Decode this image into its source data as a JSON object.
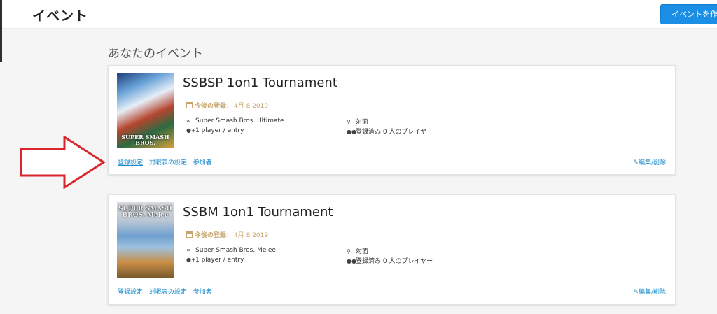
{
  "header": {
    "title": "イベント",
    "create_button": "イベントを作"
  },
  "section_title": "あなたのイベント",
  "colors": {
    "accent": "#1a8ccd",
    "button": "#1b8ee6",
    "date": "#c7a46a",
    "arrow": "#d9262c"
  },
  "events": [
    {
      "title": "SSBSP 1on1 Tournament",
      "thumb_logo": "SUPER SMASH BROS.",
      "date_label": "今後の登録：",
      "date_value": "4月 8 2019",
      "game": "Super Smash Bros. Ultimate",
      "entry": "1 player / entry",
      "venue": "対面",
      "players": "登録済み 0 人のプレイヤー",
      "links": [
        "登録設定",
        "対戦表の設定",
        "参加者"
      ],
      "edit": "編集/削除"
    },
    {
      "title": "SSBM 1on1 Tournament",
      "thumb_logo": "SUPER SMASH BROS. Melee",
      "date_label": "今後の登録：",
      "date_value": "4月 8 2019",
      "game": "Super Smash Bros. Melee",
      "entry": "1 player / entry",
      "venue": "対面",
      "players": "登録済み 0 人のプレイヤー",
      "links": [
        "登録設定",
        "対戦表の設定",
        "参加者"
      ],
      "edit": "編集/削除"
    }
  ]
}
